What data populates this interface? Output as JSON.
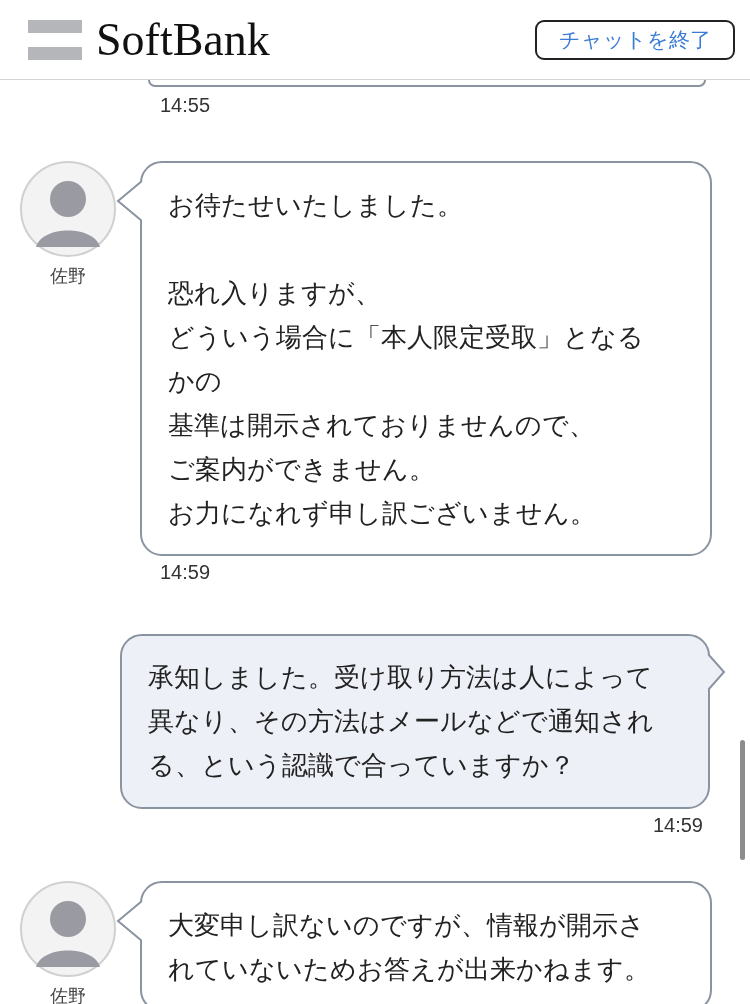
{
  "header": {
    "logo": "SoftBank",
    "end_button": "チャットを終了"
  },
  "messages": [
    {
      "kind": "cut",
      "time": "14:55"
    },
    {
      "kind": "agent",
      "name": "佐野",
      "paragraphs": [
        [
          "お待たせいたしました。"
        ],
        [
          "恐れ入りますが、",
          "どういう場合に「本人限定受取」となる",
          "かの",
          "基準は開示されておりませんので、",
          "ご案内ができません。",
          "お力になれず申し訳ございません。"
        ]
      ],
      "time": "14:59"
    },
    {
      "kind": "user",
      "paragraphs": [
        [
          "承知しました。受け取り方法は人によって",
          "異なり、その方法はメールなどで通知され",
          "る、という認識で合っていますか？"
        ]
      ],
      "time": "14:59"
    },
    {
      "kind": "agent",
      "name": "佐野",
      "paragraphs": [
        [
          "大変申し訳ないのですが、情報が開示さ",
          "れていないためお答えが出来かねます。"
        ]
      ]
    }
  ]
}
